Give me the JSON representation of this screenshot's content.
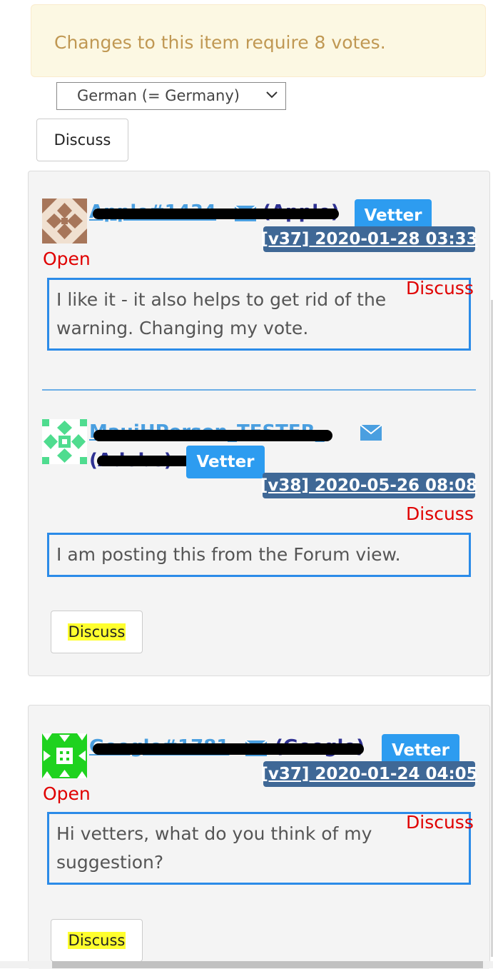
{
  "notice": {
    "text": "Changes to this item require 8 votes."
  },
  "locale_select": {
    "value": "German (= Germany)"
  },
  "discuss_top": {
    "label": "Discuss"
  },
  "panel1": {
    "post1": {
      "user": "Apple#1434",
      "org": "(Apple)",
      "role": "Vetter",
      "stamp": "[v37] 2020-01-28 03:33",
      "status": "Open",
      "discuss_link": "Discuss",
      "message": "I like it - it also helps to get rid of the warning. Changing my vote."
    },
    "post2": {
      "user": "MauiHPerson_TESTER_",
      "org": "(Adobe)",
      "role": "Vetter",
      "stamp": "[v38] 2020-05-26 08:08",
      "discuss_link": "Discuss",
      "message": "I am posting this from the Forum view."
    },
    "discuss_button": "Discuss"
  },
  "panel2": {
    "post1": {
      "user": "Google#1781",
      "org": "(Google)",
      "role": "Vetter",
      "stamp": "[v37] 2020-01-24 04:05",
      "status": "Open",
      "discuss_link": "Discuss",
      "message": "Hi vetters, what do you think of my suggestion?"
    },
    "discuss_button": "Discuss"
  },
  "colors": {
    "link_blue": "#4a9fe0",
    "org_navy": "#2e3192",
    "vetter_badge": "#2d9cf0",
    "stamp_bg": "#3f6896",
    "open_red": "#e00000",
    "message_border": "#2b8be8",
    "highlight": "#ffff2e"
  }
}
